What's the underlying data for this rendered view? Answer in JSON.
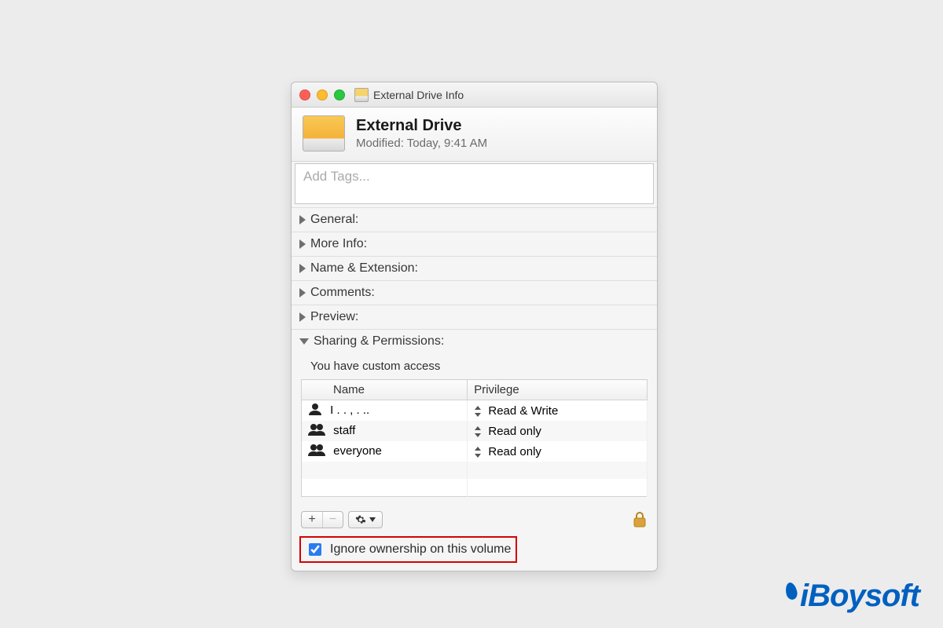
{
  "window": {
    "title": "External Drive Info"
  },
  "header": {
    "name": "External Drive",
    "modified_label": "Modified:",
    "modified_value": "Today, 9:41 AM"
  },
  "tags": {
    "placeholder": "Add Tags..."
  },
  "sections": {
    "general": "General:",
    "more_info": "More Info:",
    "name_ext": "Name & Extension:",
    "comments": "Comments:",
    "preview": "Preview:",
    "sharing": "Sharing & Permissions:"
  },
  "sharing": {
    "access_note": "You have custom access",
    "columns": {
      "name": "Name",
      "privilege": "Privilege"
    },
    "rows": [
      {
        "name": "I . . , . ..",
        "privilege": "Read & Write",
        "icon": "user"
      },
      {
        "name": "staff",
        "privilege": "Read only",
        "icon": "group"
      },
      {
        "name": "everyone",
        "privilege": "Read only",
        "icon": "group"
      }
    ]
  },
  "toolbar": {
    "add": "+",
    "remove": "−"
  },
  "ignore_ownership": {
    "label": "Ignore ownership on this volume",
    "checked": true
  },
  "watermark": "iBoysoft"
}
